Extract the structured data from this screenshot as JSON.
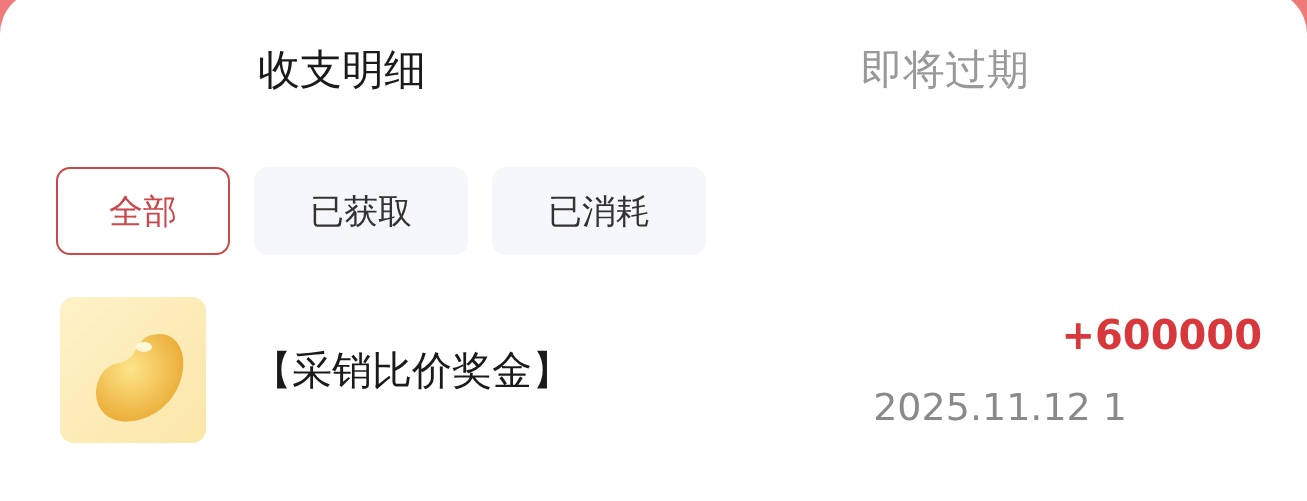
{
  "tabs": [
    {
      "label": "收支明细",
      "selected": true
    },
    {
      "label": "即将过期",
      "selected": false
    }
  ],
  "filters": [
    {
      "label": "全部",
      "selected": true
    },
    {
      "label": "已获取",
      "selected": false
    },
    {
      "label": "已消耗",
      "selected": false
    }
  ],
  "records": [
    {
      "kind": "picture",
      "title": "【采销比价奖金】",
      "amount": "+600000",
      "time": "2025.11.12 1"
    }
  ]
}
